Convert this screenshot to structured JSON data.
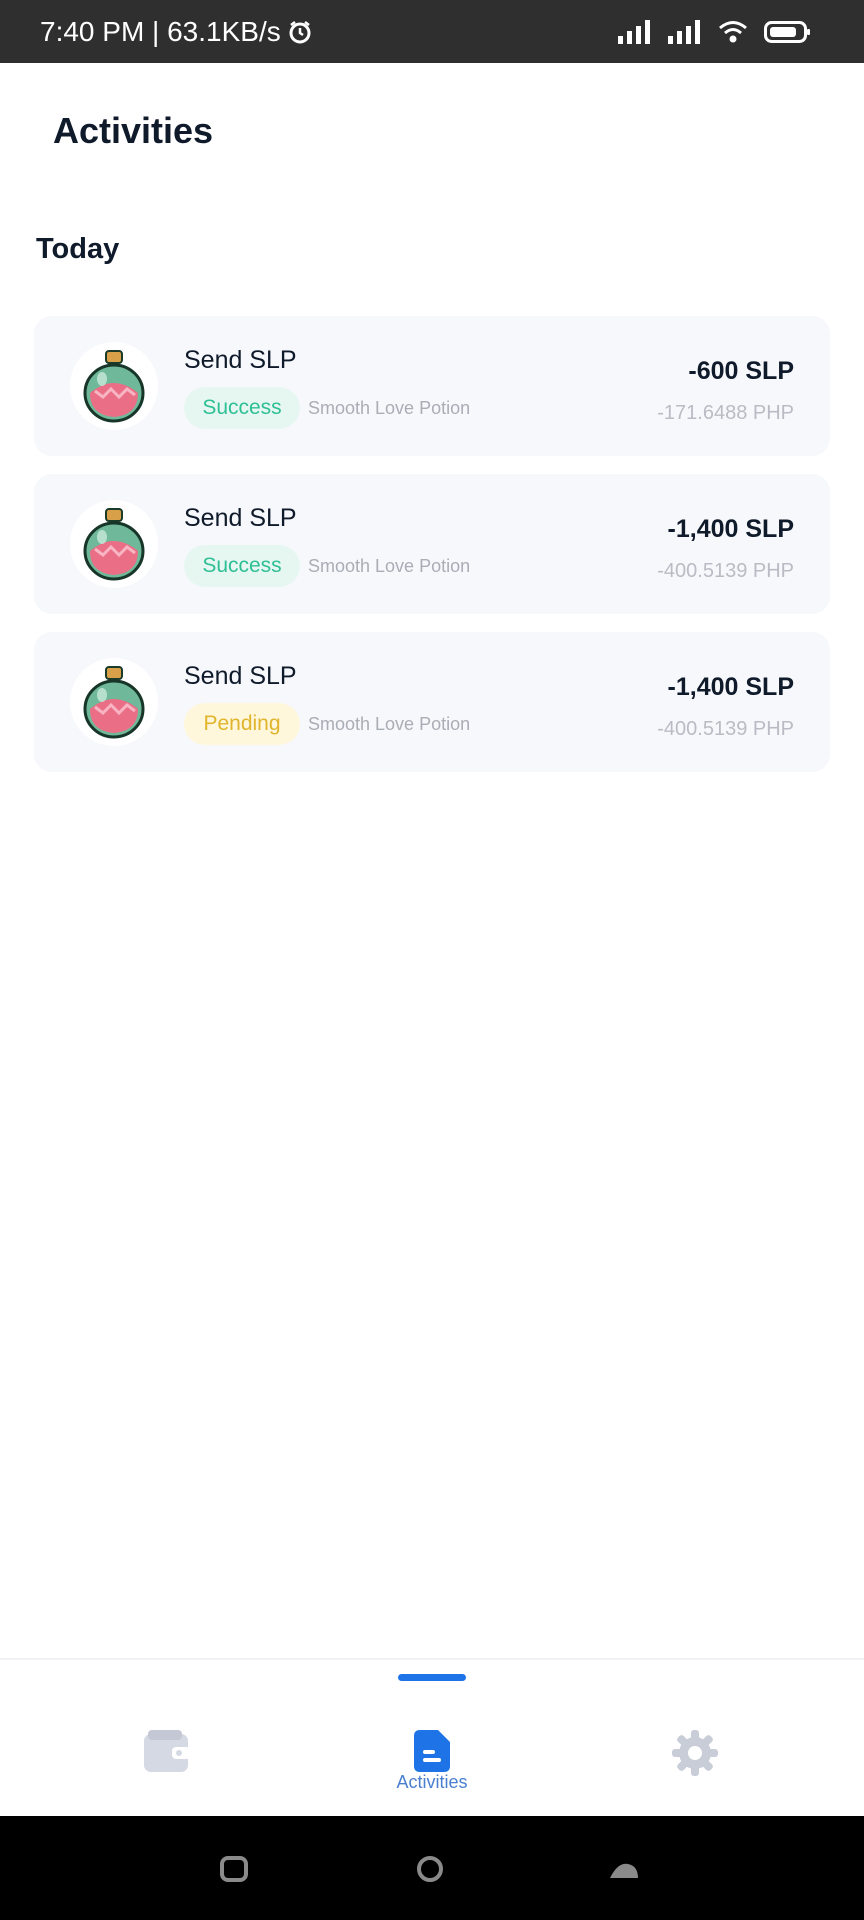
{
  "status_bar": {
    "time_speed": "7:40 PM | 63.1KB/s",
    "icons": [
      "alarm-icon",
      "signal-icon",
      "signal-icon",
      "wifi-icon",
      "battery-icon"
    ]
  },
  "header": {
    "title": "Activities"
  },
  "section": {
    "title": "Today"
  },
  "activities": [
    {
      "title": "Send SLP",
      "status": "Success",
      "status_type": "success",
      "token": "Smooth Love Potion",
      "amount": "-600 SLP",
      "fiat": "-171.6488 PHP"
    },
    {
      "title": "Send SLP",
      "status": "Success",
      "status_type": "success",
      "token": "Smooth Love Potion",
      "amount": "-1,400 SLP",
      "fiat": "-400.5139 PHP"
    },
    {
      "title": "Send SLP",
      "status": "Pending",
      "status_type": "pending",
      "token": "Smooth Love Potion",
      "amount": "-1,400 SLP",
      "fiat": "-400.5139 PHP"
    }
  ],
  "bottom_nav": {
    "items": [
      {
        "icon": "wallet-icon",
        "label": ""
      },
      {
        "icon": "activities-icon",
        "label": "Activities",
        "active": true
      },
      {
        "icon": "settings-icon",
        "label": ""
      }
    ]
  },
  "colors": {
    "accent": "#1e74e6",
    "success": "#2fbf94",
    "pending": "#e0b52b"
  }
}
